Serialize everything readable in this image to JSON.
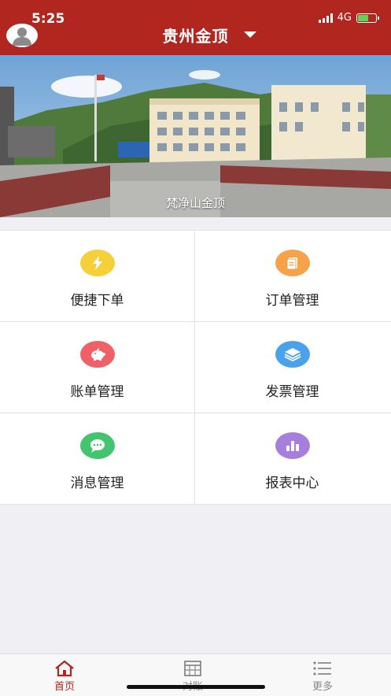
{
  "status": {
    "time": "5:25",
    "network": "4G"
  },
  "header": {
    "title": "贵州金顶"
  },
  "banner": {
    "caption": "梵净山金顶"
  },
  "menu": [
    {
      "label": "便捷下单",
      "icon": "lightning-icon",
      "color": "#f5d03a"
    },
    {
      "label": "订单管理",
      "icon": "document-icon",
      "color": "#f5a24a"
    },
    {
      "label": "账单管理",
      "icon": "piggy-bank-icon",
      "color": "#ef6166"
    },
    {
      "label": "发票管理",
      "icon": "layers-icon",
      "color": "#4aa3ea"
    },
    {
      "label": "消息管理",
      "icon": "chat-icon",
      "color": "#43c46e"
    },
    {
      "label": "报表中心",
      "icon": "bar-chart-icon",
      "color": "#a67fdc"
    }
  ],
  "tabs": [
    {
      "label": "首页",
      "active": true,
      "color": "#b1261e"
    },
    {
      "label": "对账",
      "active": false,
      "color": "#888888"
    },
    {
      "label": "更多",
      "active": false,
      "color": "#888888"
    }
  ],
  "colors": {
    "brand": "#b1261e"
  }
}
